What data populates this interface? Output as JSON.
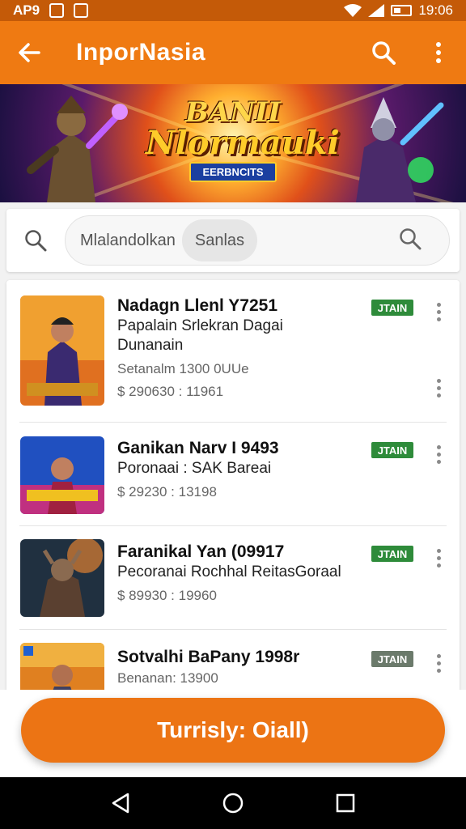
{
  "status_bar": {
    "carrier": "AP9",
    "time": "19:06"
  },
  "app_bar": {
    "title": "InporNasia"
  },
  "banner": {
    "line1": "BANII",
    "line2": "Nlormauki",
    "subtitle": "EERBNCITS"
  },
  "search": {
    "placeholder": "Mlalandolkan",
    "chip": "Sanlas"
  },
  "items": [
    {
      "name": "Nadagn Llenl Y7251",
      "line1": "Papalain Srlekran Dagai",
      "line2": "Dunanain",
      "meta1": "Setanalm 1300 0UUe",
      "meta2": "$ 290630 : 11961",
      "badge": "JTAIN"
    },
    {
      "name": "Ganikan Narv I 9493",
      "line1": "Poronaai : SAK Bareai",
      "meta2": "$ 29230 : 13198",
      "badge": "JTAIN"
    },
    {
      "name": "Faranikal Yan (09917",
      "line1": "Pecoranai Rochhal ReitasGoraal",
      "meta2": "$ 89930 : 19960",
      "badge": "JTAIN"
    },
    {
      "name": "Sotvalhi BaPany 1998r",
      "line1": "Benanan: 13900",
      "badge": "JTAIN"
    }
  ],
  "cta": {
    "label": "Turrisly: Oiall)"
  },
  "colors": {
    "primary": "#ef7a12",
    "status": "#c45a08",
    "badge": "#2e8b3a"
  }
}
